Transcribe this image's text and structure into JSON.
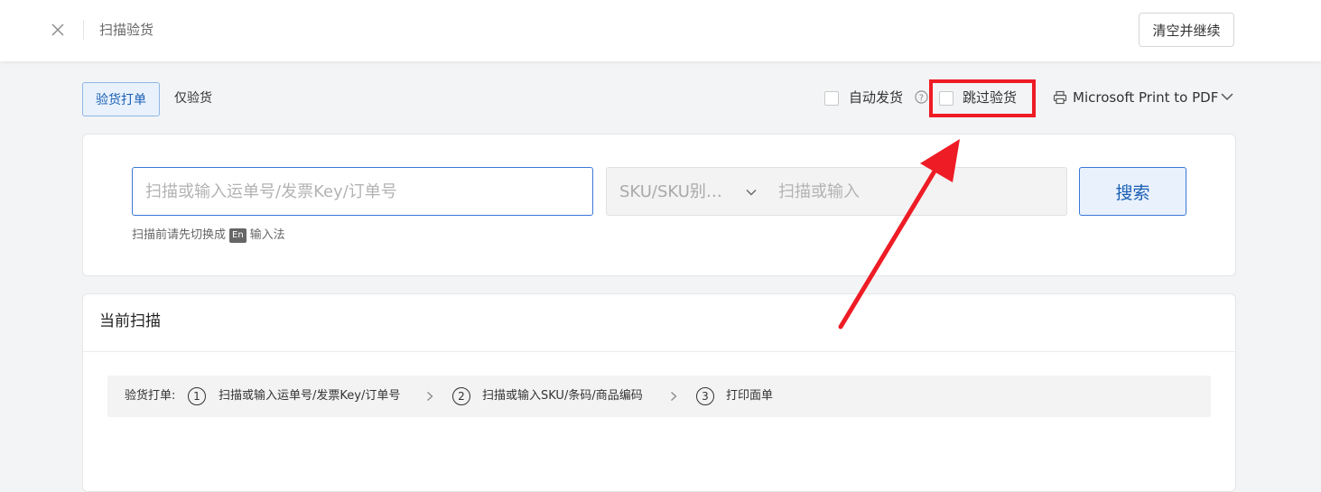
{
  "header": {
    "title": "扫描验货",
    "clear_continue_label": "清空并继续"
  },
  "modes": {
    "active_label": "验货打单",
    "other_label": "仅验货"
  },
  "options": {
    "auto_ship_label": "自动发货",
    "skip_inspection_label": "跳过验货",
    "printer_name": "Microsoft Print to PDF"
  },
  "search": {
    "scan_placeholder": "扫描或输入运单号/发票Key/订单号",
    "sku_type_label": "SKU/SKU别…",
    "sku_placeholder": "扫描或输入",
    "search_button_label": "搜索",
    "hint_before": "扫描前请先切换成",
    "hint_badge": "En",
    "hint_after": "输入法"
  },
  "current_scan": {
    "title": "当前扫描",
    "steps_label": "验货打单:",
    "steps": [
      {
        "num": "1",
        "text": "扫描或输入运单号/发票Key/订单号"
      },
      {
        "num": "2",
        "text": "扫描或输入SKU/条码/商品编码"
      },
      {
        "num": "3",
        "text": "打印面单"
      }
    ]
  },
  "colors": {
    "accent": "#1a5fb4",
    "annotation_red": "#ee1c25"
  }
}
